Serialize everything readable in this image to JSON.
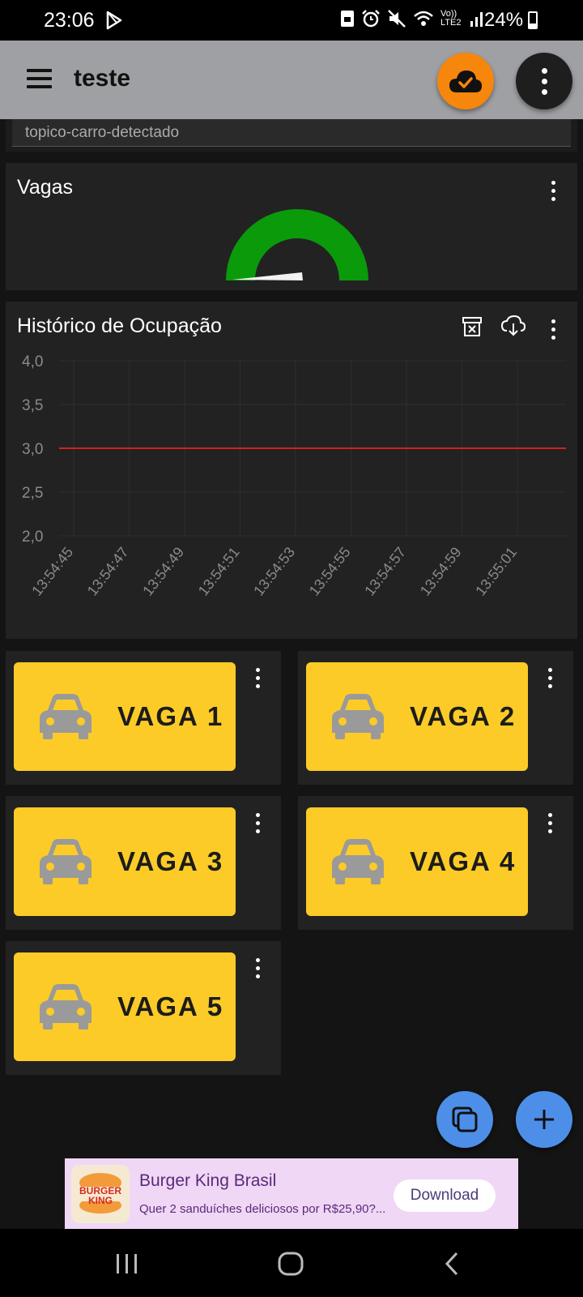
{
  "status": {
    "time": "23:06",
    "network_label": "Vo)) LTE2",
    "battery": "24%"
  },
  "appbar": {
    "title": "teste",
    "menu_icon": "hamburger-menu-icon",
    "connection_icon": "cloud-check-icon",
    "accent": "#f7860c"
  },
  "topic": {
    "value": "topico-carro-detectado"
  },
  "vagas_widget": {
    "title": "Vagas",
    "gauge_color": "#0a9a0a"
  },
  "history_widget": {
    "title": "Histórico de Ocupação",
    "icons": [
      "archive-delete-icon",
      "cloud-download-icon"
    ]
  },
  "chart_data": {
    "type": "line",
    "title": "Histórico de Ocupação",
    "x": [
      "13:54:45",
      "13:54:47",
      "13:54:49",
      "13:54:51",
      "13:54:53",
      "13:54:55",
      "13:54:57",
      "13:54:59",
      "13:55:01"
    ],
    "y_ticks": [
      "4,0",
      "3,5",
      "3,0",
      "2,5",
      "2,0"
    ],
    "ylim": [
      2.0,
      4.0
    ],
    "series": [
      {
        "values": [
          3,
          3,
          3,
          3,
          3,
          3,
          3,
          3,
          3
        ],
        "color": "#d42020"
      }
    ],
    "grid": true
  },
  "vagas": [
    {
      "label": "VAGA 1",
      "icon": "car-icon"
    },
    {
      "label": "VAGA 2",
      "icon": "car-icon"
    },
    {
      "label": "VAGA 3",
      "icon": "car-icon"
    },
    {
      "label": "VAGA 4",
      "icon": "car-icon"
    },
    {
      "label": "VAGA 5",
      "icon": "car-icon"
    }
  ],
  "vaga_color": "#fccb27",
  "fabs": {
    "copy_icon": "copy-icon",
    "add_icon": "plus-icon",
    "color": "#4d8fe8"
  },
  "ad": {
    "logo_text": "BURGER KING",
    "name": "Burger King Brasil",
    "desc": "Quer 2 sanduíches deliciosos por R$25,90?...",
    "button": "Download"
  }
}
